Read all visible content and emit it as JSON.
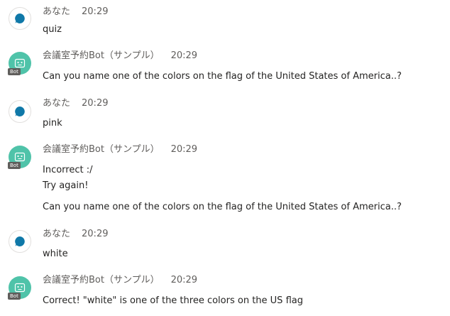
{
  "colors": {
    "user_avatar_dot": "#0f78a8",
    "bot_avatar_bg": "#4fc3a9",
    "bot_badge_bg": "#605e5c",
    "meta_text": "#605e5c",
    "body_text": "#252423"
  },
  "icons": {
    "user_avatar": "user-circle-icon",
    "bot_avatar": "bot-face-icon"
  },
  "messages": [
    {
      "author": "あなた",
      "time": "20:29",
      "lines": [
        "quiz"
      ]
    },
    {
      "author": "会議室予約Bot（サンプル）",
      "time": "20:29",
      "badge": "Bot",
      "lines": [
        "Can you name one of the colors on the flag of the United States of America..?"
      ]
    },
    {
      "author": "あなた",
      "time": "20:29",
      "lines": [
        "pink"
      ]
    },
    {
      "author": "会議室予約Bot（サンプル）",
      "time": "20:29",
      "badge": "Bot",
      "lines": [
        "Incorrect :/",
        "Try again!",
        "Can you name one of the colors on the flag of the United States of America..?"
      ]
    },
    {
      "author": "あなた",
      "time": "20:29",
      "lines": [
        "white"
      ]
    },
    {
      "author": "会議室予約Bot（サンプル）",
      "time": "20:29",
      "badge": "Bot",
      "lines": [
        "Correct! \"white\" is one of the three colors on the US flag"
      ]
    }
  ]
}
